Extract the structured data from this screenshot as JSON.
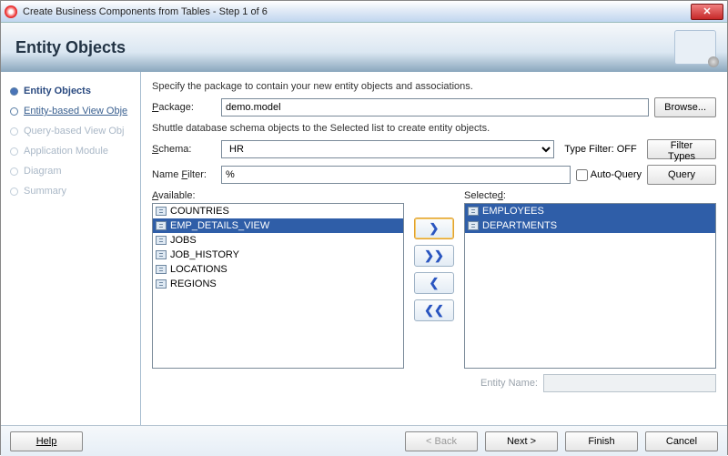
{
  "window": {
    "title": "Create Business Components from Tables - Step 1 of 6"
  },
  "banner": {
    "heading": "Entity Objects"
  },
  "sidebar": {
    "steps": [
      {
        "label": "Entity Objects"
      },
      {
        "label": "Entity-based View Obje"
      },
      {
        "label": "Query-based View Obj"
      },
      {
        "label": "Application Module"
      },
      {
        "label": "Diagram"
      },
      {
        "label": "Summary"
      }
    ]
  },
  "content": {
    "desc1": "Specify the package to contain your new entity objects and associations.",
    "package_label": "Package:",
    "package_value": "demo.model",
    "browse_label": "Browse...",
    "desc2": "Shuttle database schema objects to the Selected list to create entity objects.",
    "schema_label": "Schema:",
    "schema_value": "HR",
    "type_filter_label": "Type Filter: OFF",
    "filter_types_label": "Filter Types",
    "name_filter_label": "Name Filter:",
    "name_filter_value": "%",
    "auto_query_label": "Auto-Query",
    "query_label": "Query",
    "available_label": "Available:",
    "selected_label": "Selected:",
    "available": [
      "COUNTRIES",
      "EMP_DETAILS_VIEW",
      "JOBS",
      "JOB_HISTORY",
      "LOCATIONS",
      "REGIONS"
    ],
    "selected": [
      "EMPLOYEES",
      "DEPARTMENTS"
    ],
    "entity_name_label": "Entity Name:",
    "entity_name_value": ""
  },
  "shuttle": {
    "add": "❯",
    "add_all": "❯❯",
    "remove": "❮",
    "remove_all": "❮❮"
  },
  "footer": {
    "help": "Help",
    "back": "< Back",
    "next": "Next >",
    "finish": "Finish",
    "cancel": "Cancel"
  }
}
